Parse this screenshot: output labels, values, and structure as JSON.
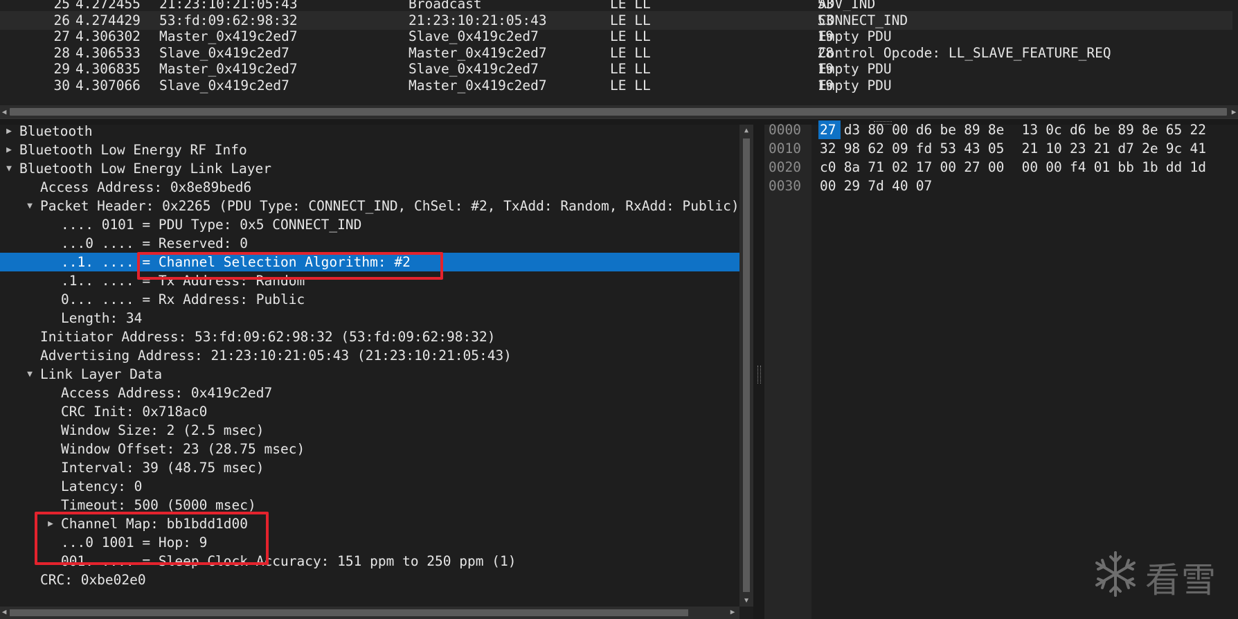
{
  "packet_list": {
    "rows": [
      {
        "no": "25",
        "time": "4.272455",
        "source": "21:23:10:21:05:43",
        "destination": "Broadcast",
        "protocol": "LE LL",
        "length": "53",
        "info": "ADV_IND",
        "selected": false
      },
      {
        "no": "26",
        "time": "4.274429",
        "source": "53:fd:09:62:98:32",
        "destination": "21:23:10:21:05:43",
        "protocol": "LE LL",
        "length": "53",
        "info": "CONNECT_IND",
        "selected": true
      },
      {
        "no": "27",
        "time": "4.306302",
        "source": "Master_0x419c2ed7",
        "destination": "Slave_0x419c2ed7",
        "protocol": "LE LL",
        "length": "19",
        "info": "Empty PDU",
        "selected": false
      },
      {
        "no": "28",
        "time": "4.306533",
        "source": "Slave_0x419c2ed7",
        "destination": "Master_0x419c2ed7",
        "protocol": "LE LL",
        "length": "28",
        "info": "Control Opcode: LL_SLAVE_FEATURE_REQ",
        "selected": false
      },
      {
        "no": "29",
        "time": "4.306835",
        "source": "Master_0x419c2ed7",
        "destination": "Slave_0x419c2ed7",
        "protocol": "LE LL",
        "length": "19",
        "info": "Empty PDU",
        "selected": false
      },
      {
        "no": "30",
        "time": "4.307066",
        "source": "Slave_0x419c2ed7",
        "destination": "Master_0x419c2ed7",
        "protocol": "LE LL",
        "length": "19",
        "info": "Empty PDU",
        "selected": false
      }
    ]
  },
  "details": {
    "nodes": [
      {
        "text": "Bluetooth",
        "level": 0,
        "toggle": "collapsed"
      },
      {
        "text": "Bluetooth Low Energy RF Info",
        "level": 0,
        "toggle": "collapsed"
      },
      {
        "text": "Bluetooth Low Energy Link Layer",
        "level": 0,
        "toggle": "expanded"
      },
      {
        "text": "Access Address: 0x8e89bed6",
        "level": 1,
        "toggle": "none"
      },
      {
        "text": "Packet Header: 0x2265 (PDU Type: CONNECT_IND, ChSel: #2, TxAdd: Random, RxAdd: Public)",
        "level": 1,
        "toggle": "expanded"
      },
      {
        "text": ".... 0101 = PDU Type: 0x5 CONNECT_IND",
        "level": 2,
        "toggle": "none"
      },
      {
        "text": "...0 .... = Reserved: 0",
        "level": 2,
        "toggle": "none"
      },
      {
        "text": "..1. .... = Channel Selection Algorithm: #2",
        "level": 2,
        "toggle": "none",
        "selected": true
      },
      {
        "text": ".1.. .... = Tx Address: Random",
        "level": 2,
        "toggle": "none"
      },
      {
        "text": "0... .... = Rx Address: Public",
        "level": 2,
        "toggle": "none"
      },
      {
        "text": "Length: 34",
        "level": 2,
        "toggle": "none"
      },
      {
        "text": "Initiator Address: 53:fd:09:62:98:32 (53:fd:09:62:98:32)",
        "level": 1,
        "toggle": "none"
      },
      {
        "text": "Advertising Address: 21:23:10:21:05:43 (21:23:10:21:05:43)",
        "level": 1,
        "toggle": "none"
      },
      {
        "text": "Link Layer Data",
        "level": 1,
        "toggle": "expanded"
      },
      {
        "text": "Access Address: 0x419c2ed7",
        "level": 2,
        "toggle": "none"
      },
      {
        "text": "CRC Init: 0x718ac0",
        "level": 2,
        "toggle": "none"
      },
      {
        "text": "Window Size: 2 (2.5 msec)",
        "level": 2,
        "toggle": "none"
      },
      {
        "text": "Window Offset: 23 (28.75 msec)",
        "level": 2,
        "toggle": "none"
      },
      {
        "text": "Interval: 39 (48.75 msec)",
        "level": 2,
        "toggle": "none"
      },
      {
        "text": "Latency: 0",
        "level": 2,
        "toggle": "none"
      },
      {
        "text": "Timeout: 500 (5000 msec)",
        "level": 2,
        "toggle": "none"
      },
      {
        "text": "Channel Map: bb1bdd1d00",
        "level": 2,
        "toggle": "collapsed"
      },
      {
        "text": "...0 1001 = Hop: 9",
        "level": 2,
        "toggle": "none"
      },
      {
        "text": "001. .... = Sleep Clock Accuracy: 151 ppm to 250 ppm (1)",
        "level": 2,
        "toggle": "none"
      },
      {
        "text": "CRC: 0xbe02e0",
        "level": 1,
        "toggle": "none"
      }
    ]
  },
  "hex": {
    "rows": [
      {
        "offset": "0000",
        "bytes": [
          "27",
          "d3",
          "80",
          "00",
          "d6",
          "be",
          "89",
          "8e",
          "13",
          "0c",
          "d6",
          "be",
          "89",
          "8e",
          "65",
          "22"
        ]
      },
      {
        "offset": "0010",
        "bytes": [
          "32",
          "98",
          "62",
          "09",
          "fd",
          "53",
          "43",
          "05",
          "21",
          "10",
          "23",
          "21",
          "d7",
          "2e",
          "9c",
          "41"
        ]
      },
      {
        "offset": "0020",
        "bytes": [
          "c0",
          "8a",
          "71",
          "02",
          "17",
          "00",
          "27",
          "00",
          "00",
          "00",
          "f4",
          "01",
          "bb",
          "1b",
          "dd",
          "1d"
        ]
      },
      {
        "offset": "0030",
        "bytes": [
          "00",
          "29",
          "7d",
          "40",
          "07"
        ]
      }
    ],
    "highlight_byte": 0
  },
  "watermark": {
    "text": "看雪"
  },
  "colors": {
    "background": "#1e1e1e",
    "selection": "#0f72c6",
    "annotation": "#e3232d",
    "text": "#e6e6e6"
  }
}
